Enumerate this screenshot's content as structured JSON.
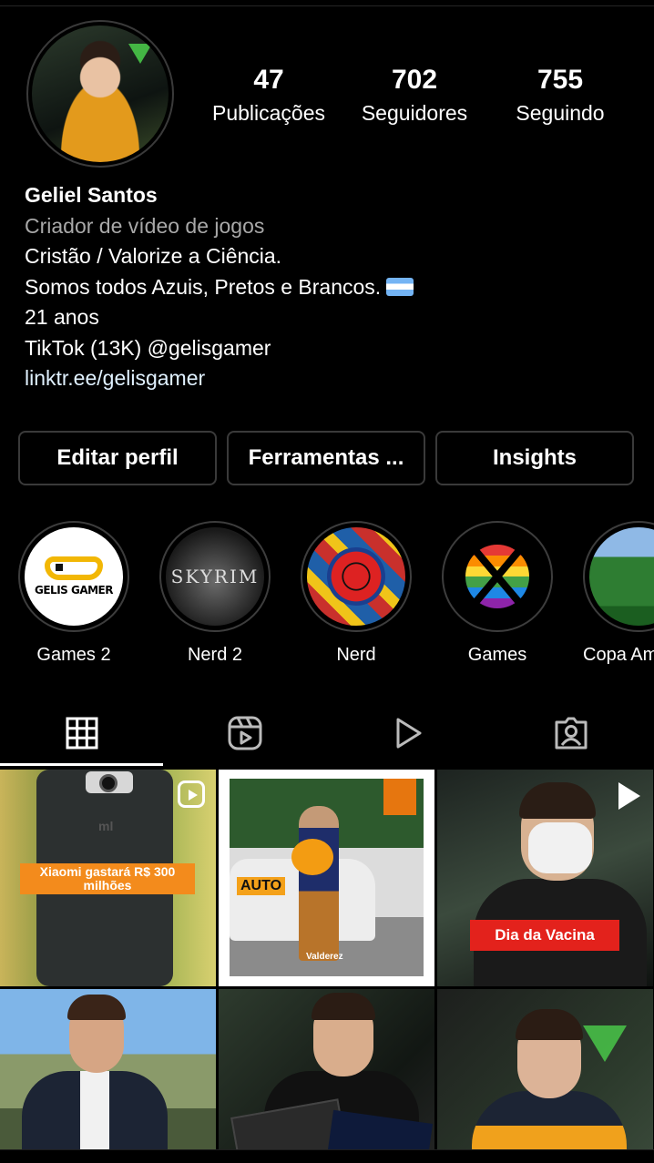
{
  "profile": {
    "stats": [
      {
        "value": "47",
        "label": "Publicações"
      },
      {
        "value": "702",
        "label": "Seguidores"
      },
      {
        "value": "755",
        "label": "Seguindo"
      }
    ],
    "name": "Geliel Santos",
    "category": "Criador de vídeo de jogos",
    "bio_lines": [
      "Cristão / Valorize a Ciência.",
      "Somos todos Azuis, Pretos e Brancos.",
      "21 anos",
      "TikTok (13K) @gelisgamer"
    ],
    "link": "linktr.ee/gelisgamer"
  },
  "buttons": {
    "edit": "Editar perfil",
    "tools": "Ferramentas ...",
    "insights": "Insights"
  },
  "highlights": [
    {
      "label": "Games 2",
      "cover_text": "GELIS GAMER"
    },
    {
      "label": "Nerd 2",
      "cover_text": "SKYRIM"
    },
    {
      "label": "Nerd"
    },
    {
      "label": "Games"
    },
    {
      "label": "Copa Am"
    }
  ],
  "tabs": [
    {
      "name": "grid-icon",
      "active": true
    },
    {
      "name": "reels-icon"
    },
    {
      "name": "video-play-icon"
    },
    {
      "name": "tagged-icon"
    }
  ],
  "posts": {
    "post1_caption": "Xiaomi gastará R$ 300 milhões",
    "post2_caption": "AUTO",
    "post2_logo": "Valderez",
    "post3_caption": "Dia da Vacina"
  },
  "colors": {
    "background": "#000000",
    "secondary_text": "#a8a8a8",
    "border": "#3a3a3a",
    "banner_orange": "#f38b1c",
    "banner_red": "#e3221c"
  }
}
